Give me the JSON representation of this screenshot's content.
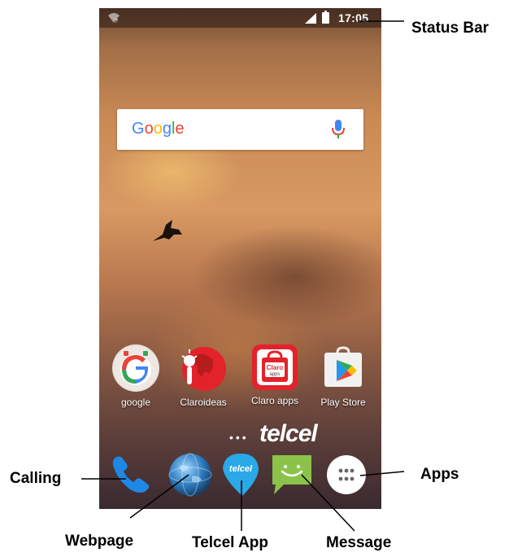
{
  "status_bar": {
    "time": "17:05"
  },
  "search": {
    "logo_letters": [
      "G",
      "o",
      "o",
      "g",
      "l",
      "e"
    ]
  },
  "home_apps": [
    {
      "label": "google"
    },
    {
      "label": "Claroideas"
    },
    {
      "label": "Claro apps"
    },
    {
      "label": "Play Store"
    }
  ],
  "claro_badge": {
    "top": "Claro",
    "bottom": "apps"
  },
  "branding": {
    "dots": "•••",
    "carrier": "telcel"
  },
  "dock": [
    {
      "icon": "phone-icon"
    },
    {
      "icon": "globe-icon"
    },
    {
      "icon": "telcel-icon",
      "text": "telcel"
    },
    {
      "icon": "message-icon"
    },
    {
      "icon": "apps-drawer-icon"
    }
  ],
  "callouts": {
    "status_bar": "Status Bar",
    "calling": "Calling",
    "apps": "Apps",
    "webpage": "Webpage",
    "telcel_app": "Telcel App",
    "message": "Message"
  },
  "colors": {
    "google_blue": "#4285F4",
    "google_red": "#EA4335",
    "google_yellow": "#FBBC05",
    "google_green": "#34A853",
    "phone_blue": "#1e88e5",
    "message_green": "#8bc34a",
    "claro_red": "#e4222a"
  }
}
